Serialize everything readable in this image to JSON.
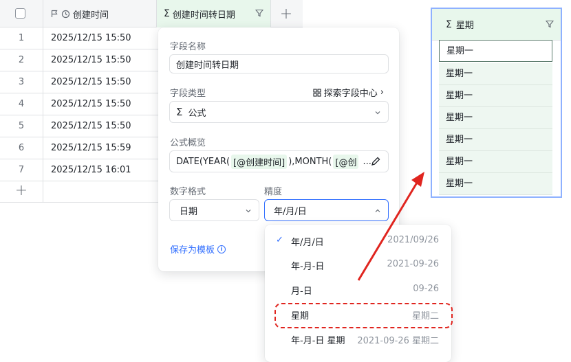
{
  "table": {
    "header": {
      "col1_label": "创建时间",
      "col2_label": "创建时间转日期",
      "add_column_label": "+"
    },
    "rows": [
      {
        "index": "1",
        "created": "2025/12/15 15:50"
      },
      {
        "index": "2",
        "created": "2025/12/15 15:50"
      },
      {
        "index": "3",
        "created": "2025/12/15 15:50"
      },
      {
        "index": "4",
        "created": "2025/12/15 15:50"
      },
      {
        "index": "5",
        "created": "2025/12/15 15:50"
      },
      {
        "index": "6",
        "created": "2025/12/15 15:59"
      },
      {
        "index": "7",
        "created": "2025/12/15 16:01"
      }
    ],
    "add_row_label": "+"
  },
  "panel": {
    "field_name_label": "字段名称",
    "field_name_value": "创建时间转日期",
    "field_type_label": "字段类型",
    "explore_label": "探索字段中心",
    "field_type_value": "公式",
    "field_type_icon": "sigma-icon",
    "formula_label": "公式概览",
    "formula_prefix": "DATE(YEAR(",
    "formula_tag1": "[@创建时间]",
    "formula_mid": "),MONTH(",
    "formula_tag2": "[@创",
    "formula_ellipsis": "...",
    "number_format_label": "数字格式",
    "number_format_value": "日期",
    "precision_label": "精度",
    "precision_value": "年/月/日",
    "save_template_label": "保存为模板"
  },
  "dropdown": {
    "options": [
      {
        "name": "年/月/日",
        "example": "2021/09/26",
        "selected": true
      },
      {
        "name": "年-月-日",
        "example": "2021-09-26",
        "selected": false
      },
      {
        "name": "月-日",
        "example": "09-26",
        "selected": false
      },
      {
        "name": "星期",
        "example": "星期二",
        "selected": false
      },
      {
        "name": "年-月-日 星期",
        "example": "2021-09-26 星期二",
        "selected": false
      }
    ],
    "check_mark": "✓"
  },
  "preview": {
    "header_label": "星期",
    "cells": [
      "星期一",
      "星期一",
      "星期一",
      "星期一",
      "星期一",
      "星期一",
      "星期一"
    ]
  },
  "colors": {
    "accent": "#3370ff",
    "formula_green": "#e8f7ec",
    "annotation_red": "#e0251f"
  }
}
